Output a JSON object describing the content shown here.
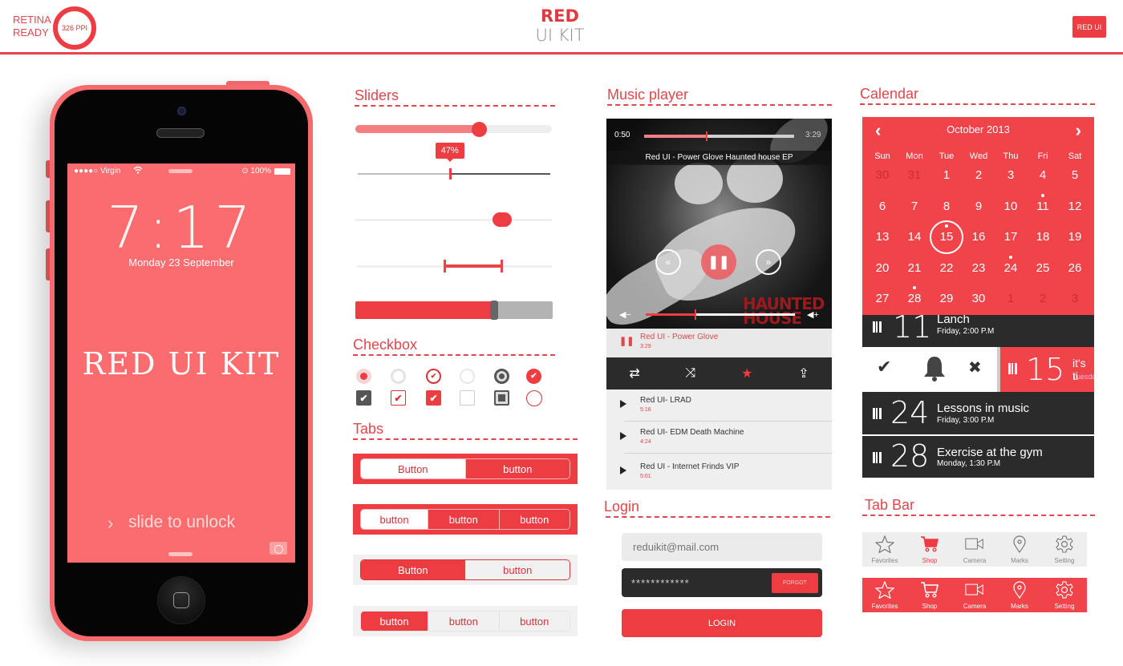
{
  "header": {
    "retina_line1": "RETINA",
    "retina_line2": "READY",
    "ppi": "326 PPI",
    "brand_title": "RED",
    "brand_subtitle": "UI KIT",
    "corner_button": "RED UI"
  },
  "colors": {
    "accent": "#ee3c43",
    "phone_body": "#f66a6d",
    "screen": "#fb6c6e",
    "dark": "#2b2b2b",
    "light_gray": "#efefef"
  },
  "phone": {
    "carrier": "●●●●○ Virgin",
    "battery": "100%",
    "time": "7:17",
    "date": "Monday 23 September",
    "headline": "RED UI KIT",
    "slide_text": "slide to unlock",
    "slide_chevron": "›"
  },
  "sliders": {
    "title": "Sliders",
    "slider1_value": 0.63,
    "slider2_value": 0.47,
    "slider2_label": "47%",
    "slider3_value": 0.72,
    "range_low": 0.45,
    "range_high": 0.74,
    "slider5_value": 0.7
  },
  "checkbox": {
    "title": "Checkbox",
    "radios": [
      {
        "state": "selected-dot"
      },
      {
        "state": "unselected-gray"
      },
      {
        "state": "checked-outline"
      },
      {
        "state": "unselected-light"
      },
      {
        "state": "selected-dark"
      },
      {
        "state": "checked-filled"
      }
    ],
    "boxes": [
      {
        "state": "checked-dark"
      },
      {
        "state": "checked-outline"
      },
      {
        "state": "checked-filled"
      },
      {
        "state": "unchecked"
      },
      {
        "state": "indeterminate-dark"
      },
      {
        "state": "unchecked-circle"
      }
    ],
    "check_glyph": "✔"
  },
  "tabs": {
    "title": "Tabs",
    "groups": [
      {
        "labels": [
          "Button",
          "button"
        ],
        "active": 0,
        "style": "red-bg"
      },
      {
        "labels": [
          "button",
          "button",
          "button"
        ],
        "active": 0,
        "style": "red-bg"
      },
      {
        "labels": [
          "Button",
          "button"
        ],
        "active": 0,
        "style": "gray-bg"
      },
      {
        "labels": [
          "button",
          "button",
          "button"
        ],
        "active": 0,
        "style": "gray-bg"
      }
    ]
  },
  "music": {
    "title": "Music player",
    "elapsed": "0:50",
    "total": "3:29",
    "progress": 0.41,
    "album_title": "Red UI - Power Glove Haunted house EP",
    "volume": 0.33,
    "art_text": "HAUNTED HOUSE",
    "now_playing": {
      "title": "Red UI - Power Glove",
      "duration": "3:29"
    },
    "controls": {
      "repeat": "⇄",
      "shuffle": "⤨",
      "favorite": "★",
      "share": "⇪",
      "rewind": "«",
      "pause": "❚❚",
      "forward": "»"
    },
    "playlist": [
      {
        "title": "Red UI- LRAD",
        "duration": "5:16"
      },
      {
        "title": "Red UI- EDM Death Machine",
        "duration": "4:24"
      },
      {
        "title": "Red UI - Internet Frinds VIP",
        "duration": "5:01"
      }
    ]
  },
  "login": {
    "title": "Login",
    "email_placeholder": "reduikit@mail.com",
    "password_value": "************",
    "forgot_label": "FORGOT",
    "login_label": "LOGIN"
  },
  "calendar": {
    "title": "Calendar",
    "month": "October 2013",
    "prev": "‹",
    "next": "›",
    "weekdays": [
      "Sun",
      "Mon",
      "Tue",
      "Wed",
      "Thu",
      "Fri",
      "Sat"
    ],
    "weeks": [
      [
        "30",
        "31",
        "1",
        "2",
        "3",
        "4",
        "5"
      ],
      [
        "6",
        "7",
        "8",
        "9",
        "10",
        "11",
        "12"
      ],
      [
        "13",
        "14",
        "15",
        "16",
        "17",
        "18",
        "19"
      ],
      [
        "20",
        "21",
        "22",
        "23",
        "24",
        "25",
        "26"
      ],
      [
        "27",
        "28",
        "29",
        "30",
        "1",
        "2",
        "3"
      ]
    ],
    "muted": [
      [
        0,
        0
      ],
      [
        0,
        1
      ],
      [
        4,
        4
      ],
      [
        4,
        5
      ],
      [
        4,
        6
      ]
    ],
    "event_dots": [
      [
        1,
        5
      ],
      [
        2,
        2
      ],
      [
        3,
        4
      ],
      [
        4,
        1
      ]
    ],
    "today": [
      2,
      2
    ],
    "events": [
      {
        "day": "11",
        "title": "Lanch",
        "when": "Friday, 2:00 P.M"
      },
      {
        "day": "15",
        "title": "it's ti",
        "when": "Tuesda"
      },
      {
        "day": "24",
        "title": "Lessons in music",
        "when": "Friday, 3:00 P.M"
      },
      {
        "day": "28",
        "title": "Exercise at the gym",
        "when": "Monday, 1:30 P.M"
      }
    ],
    "swipe_actions": {
      "accept": "✔",
      "remind": "bell",
      "dismiss": "✖"
    }
  },
  "tabbar": {
    "title": "Tab Bar",
    "items": [
      {
        "label": "Favorites",
        "icon": "star-icon"
      },
      {
        "label": "Shop",
        "icon": "cart-icon"
      },
      {
        "label": "Camera",
        "icon": "video-camera-icon"
      },
      {
        "label": "Marks",
        "icon": "map-pin-icon"
      },
      {
        "label": "Setting",
        "icon": "gear-icon"
      }
    ],
    "light_active_index": 1
  }
}
